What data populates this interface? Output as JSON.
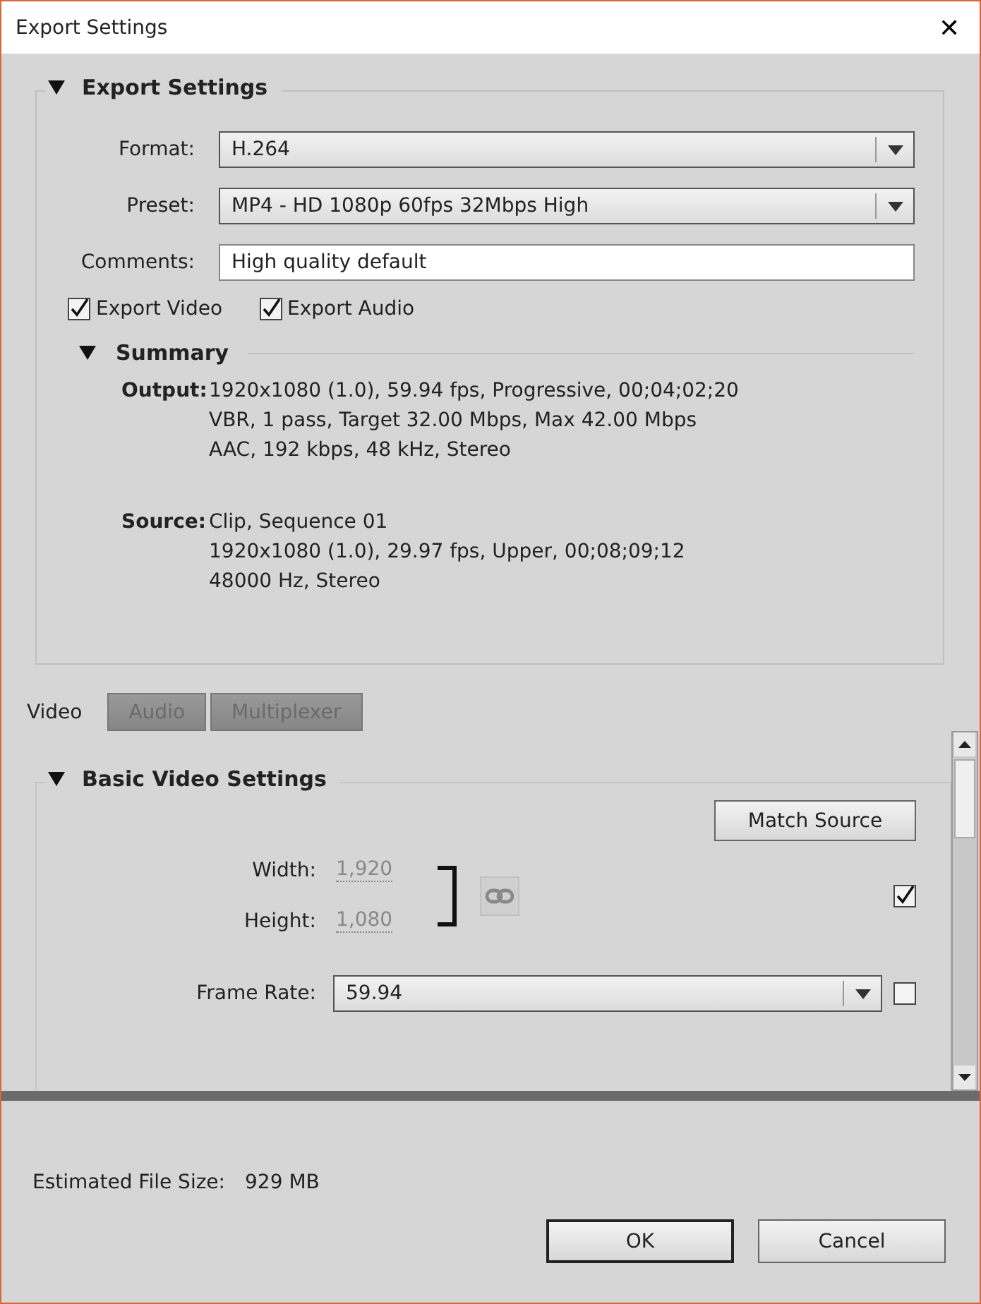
{
  "window": {
    "title": "Export Settings",
    "close": "✕"
  },
  "export_settings": {
    "title": "Export Settings",
    "expanded": true,
    "fields": [
      {
        "kind": "dropdown",
        "label": "Format:",
        "value": "H.264"
      },
      {
        "kind": "dropdown",
        "label": "Preset:",
        "value": "MP4 - HD 1080p 60fps 32Mbps High"
      },
      {
        "kind": "text",
        "label": "Comments:",
        "value": "High quality default"
      }
    ],
    "checkboxes": [
      {
        "label": "Export Video",
        "checked": true
      },
      {
        "label": "Export Audio",
        "checked": true
      }
    ],
    "summary": {
      "title": "Summary",
      "expanded": true,
      "groups": [
        {
          "label": "Output:",
          "lines": [
            "1920x1080 (1.0), 59.94 fps, Progressive, 00;04;02;20",
            "VBR, 1 pass, Target 32.00 Mbps, Max 42.00 Mbps",
            "AAC, 192 kbps, 48 kHz, Stereo"
          ]
        },
        {
          "label": "Source:",
          "lines": [
            "Clip, Sequence 01",
            "1920x1080 (1.0), 29.97 fps, Upper, 00;08;09;12",
            "48000 Hz, Stereo"
          ]
        }
      ]
    }
  },
  "tabs": [
    {
      "label": "Video",
      "selected": true
    },
    {
      "label": "Audio",
      "selected": false
    },
    {
      "label": "Multiplexer",
      "selected": false
    }
  ],
  "basic_video": {
    "title": "Basic Video Settings",
    "expanded": true,
    "match_source": "Match Source",
    "width": {
      "label": "Width:",
      "value": "1,920"
    },
    "height": {
      "label": "Height:",
      "value": "1,080"
    },
    "size_checked": true,
    "frame_rate": {
      "label": "Frame Rate:",
      "value": "59.94",
      "checked": false
    }
  },
  "estimated": {
    "label": "Estimated File Size:",
    "value": "929 MB"
  },
  "buttons": [
    {
      "label": "OK",
      "default": true
    },
    {
      "label": "Cancel",
      "default": false
    }
  ]
}
